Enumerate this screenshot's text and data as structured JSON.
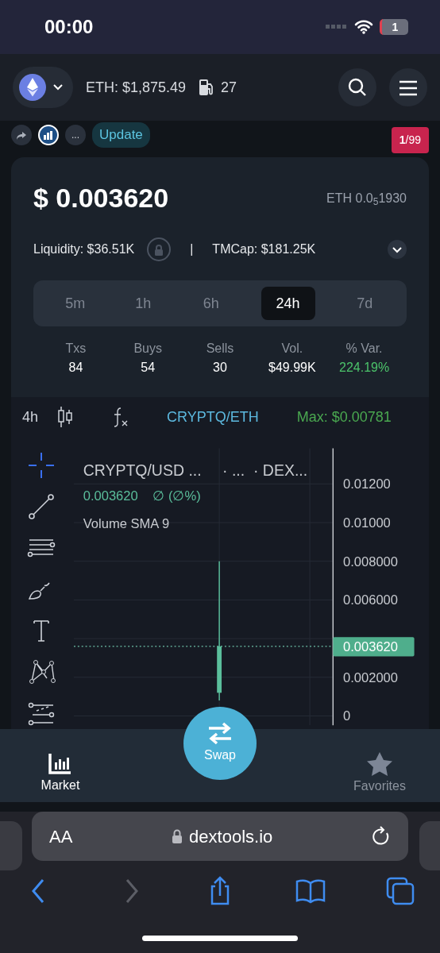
{
  "status_bar": {
    "time": "00:00",
    "battery": "1"
  },
  "header": {
    "eth_price": "ETH: $1,875.49",
    "gas": "27"
  },
  "token_bar": {
    "more": "...",
    "update": "Update",
    "counter": "**1**/99"
  },
  "price_card": {
    "price": "$ 0.003620",
    "eth_price": "ETH 0.0$_{5}$1930",
    "liquidity": "Liquidity: $36.51K",
    "separator": "|",
    "mcap": "TMCap: $181.25K",
    "tabs": [
      {
        "label": "5m",
        "selected": false
      },
      {
        "label": "1h",
        "selected": false
      },
      {
        "label": "6h",
        "selected": false
      },
      {
        "label": "24h",
        "selected": true
      },
      {
        "label": "7d",
        "selected": false
      }
    ],
    "stats": [
      {
        "label": "Txs",
        "value": "84",
        "positive": false
      },
      {
        "label": "Buys",
        "value": "54",
        "positive": false
      },
      {
        "label": "Sells",
        "value": "30",
        "positive": false
      },
      {
        "label": "Vol.",
        "value": "$49.99K",
        "positive": false
      },
      {
        "label": "% Var.",
        "value": "224.19%",
        "positive": true
      }
    ]
  },
  "chart": {
    "interval": "4h",
    "pair": "CRYPTQ/ETH",
    "max": "Max: $0.00781",
    "tools": [
      {
        "kind": "crosshair",
        "selected": true
      },
      {
        "kind": "trendline",
        "selected": false
      },
      {
        "kind": "channels",
        "selected": false
      },
      {
        "kind": "brush",
        "selected": false
      },
      {
        "kind": "text",
        "selected": false
      },
      {
        "kind": "pattern",
        "selected": false
      },
      {
        "kind": "fibonacci",
        "selected": false
      }
    ],
    "legend_title": "CRYPTQ/USD ...",
    "legend_part_2": "· ...",
    "legend_part_3": "· DEX...",
    "legend_price": "0.003620",
    "legend_change": "∅ (∅%)",
    "indicator": "Volume SMA 9",
    "axis_labels": [
      "0.01200",
      "0.01000",
      "0.008000",
      "0.006000",
      "0.002000",
      "0"
    ],
    "current_price": "0.003620"
  },
  "bottom_nav": [
    {
      "kind": "market",
      "label": "Market",
      "selected": true
    },
    {
      "kind": "swap",
      "label": "Swap",
      "selected": false
    },
    {
      "kind": "favorites",
      "label": "Favorites",
      "selected": false
    }
  ],
  "browser": {
    "text_size": "AA",
    "url": "dextools.io",
    "toolbar": [
      {
        "kind": "back",
        "disabled": false
      },
      {
        "kind": "forward",
        "disabled": true
      },
      {
        "kind": "share",
        "disabled": false
      },
      {
        "kind": "bookmarks",
        "disabled": false
      },
      {
        "kind": "tabs",
        "disabled": false
      }
    ]
  }
}
